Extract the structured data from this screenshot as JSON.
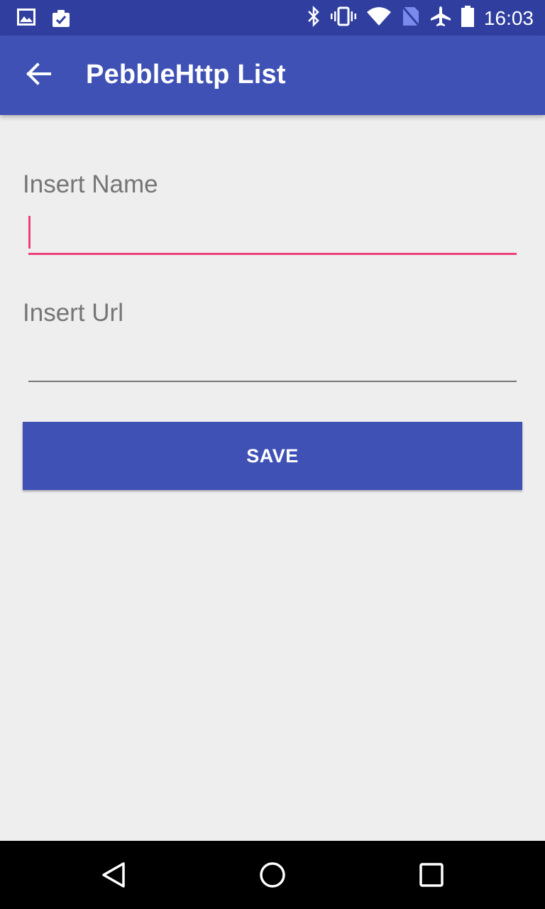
{
  "status_bar": {
    "time": "16:03",
    "left_icons": [
      "image-icon",
      "clipboard-check-icon"
    ],
    "right_icons": [
      "bluetooth-icon",
      "vibrate-icon",
      "wifi-icon",
      "no-sim-icon",
      "airplane-icon",
      "battery-icon"
    ]
  },
  "app_bar": {
    "title": "PebbleHttp List",
    "back_icon": "arrow-back-icon"
  },
  "form": {
    "name_label": "Insert Name",
    "name_value": "",
    "url_label": "Insert Url",
    "url_value": "",
    "save_label": "SAVE"
  },
  "nav_bar": {
    "icons": [
      "back-triangle-icon",
      "home-circle-icon",
      "recents-square-icon"
    ]
  },
  "colors": {
    "primary": "#3f51b5",
    "primary_dark": "#303f9f",
    "accent": "#ec407a",
    "background": "#eeeeee"
  }
}
